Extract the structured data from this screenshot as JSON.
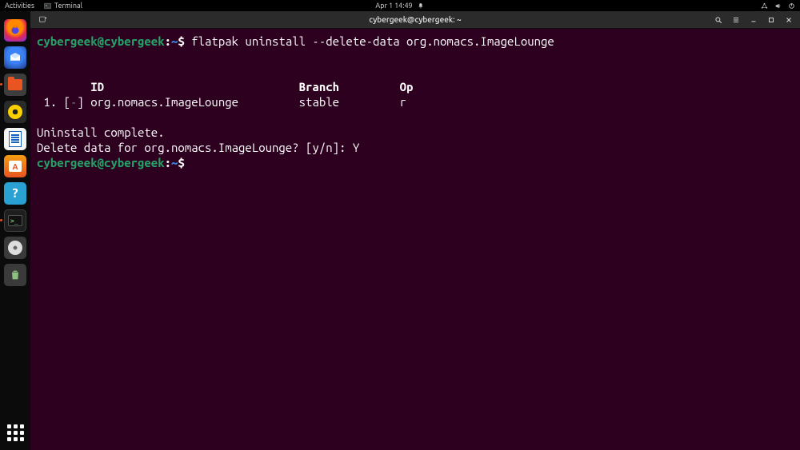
{
  "top_panel": {
    "activities": "Activities",
    "app_name": "Terminal",
    "clock": "Apr 1  14:49"
  },
  "window": {
    "title": "cybergeek@cybergeek: ~"
  },
  "prompt": {
    "user_host": "cybergeek@cybergeek",
    "sep": ":",
    "path": "~",
    "symbol": "$"
  },
  "session": {
    "command": "flatpak uninstall --delete-data org.nomacs.ImageLounge",
    "table": {
      "headers": {
        "id": "ID",
        "branch": "Branch",
        "op": "Op"
      },
      "row": {
        "index": " 1.",
        "flag_open": "[",
        "flag_dash": "-",
        "flag_close": "]",
        "id": "org.nomacs.ImageLounge",
        "branch": "stable",
        "op": "r"
      }
    },
    "complete_msg": "Uninstall complete.",
    "delete_prompt": "Delete data for org.nomacs.ImageLounge? [y/n]: ",
    "delete_answer": "Y"
  },
  "dock": {
    "items": [
      {
        "name": "firefox"
      },
      {
        "name": "thunderbird"
      },
      {
        "name": "files"
      },
      {
        "name": "rhythmbox"
      },
      {
        "name": "libreoffice-writer"
      },
      {
        "name": "ubuntu-software"
      },
      {
        "name": "help"
      },
      {
        "name": "terminal"
      },
      {
        "name": "removable-disk"
      },
      {
        "name": "trash"
      }
    ]
  }
}
